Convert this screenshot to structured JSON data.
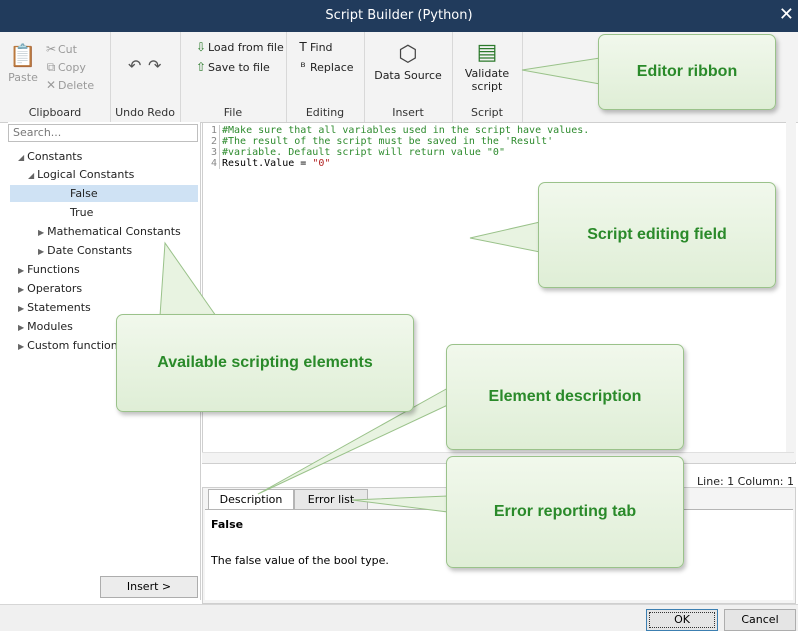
{
  "window": {
    "title": "Script Builder (Python)",
    "close_glyph": "✕"
  },
  "ribbon": {
    "clipboard": {
      "label": "Clipboard",
      "paste": "Paste",
      "cut": "Cut",
      "copy": "Copy",
      "delete": "Delete"
    },
    "undo_redo": {
      "label": "Undo Redo"
    },
    "file": {
      "label": "File",
      "load": "Load from file",
      "save": "Save to file"
    },
    "editing": {
      "label": "Editing",
      "find": "Find",
      "replace": "Replace"
    },
    "insert": {
      "label": "Insert",
      "data_source": "Data Source"
    },
    "script": {
      "label": "Script",
      "validate_line1": "Validate",
      "validate_line2": "script"
    }
  },
  "left": {
    "search_placeholder": "Search...",
    "tree": {
      "constants": "Constants",
      "logical": "Logical Constants",
      "false": "False",
      "true": "True",
      "math": "Mathematical Constants",
      "date": "Date Constants",
      "functions": "Functions",
      "operators": "Operators",
      "statements": "Statements",
      "modules": "Modules",
      "custom": "Custom functions"
    },
    "insert_button": "Insert >"
  },
  "editor": {
    "lines": [
      {
        "num": "1",
        "text": "#Make sure that all variables used in the script have values."
      },
      {
        "num": "2",
        "text": "#The result of the script must be saved in the 'Result'"
      },
      {
        "num": "3",
        "text": "#variable. Default script will return value \"0\""
      },
      {
        "num": "4",
        "code": "Result.Value = ",
        "str": "\"0\""
      }
    ],
    "status": "Line: 1 Column: 1"
  },
  "lower": {
    "tab_description": "Description",
    "tab_errors": "Error list",
    "desc_title": "False",
    "desc_text": "The false value of the bool type."
  },
  "buttons": {
    "ok": "OK",
    "cancel": "Cancel"
  },
  "callouts": {
    "ribbon": "Editor ribbon",
    "script": "Script editing field",
    "elements": "Available scripting elements",
    "description": "Element description",
    "errors": "Error reporting tab"
  },
  "colors": {
    "titlebar": "#213b5c",
    "callout_text": "#2a8a2a",
    "comment": "#2e8b2e",
    "selection": "#cfe2f4"
  },
  "icons": [
    "paste-icon",
    "cut-icon",
    "copy-icon",
    "delete-icon",
    "undo-icon",
    "redo-icon",
    "load-file-icon",
    "save-file-icon",
    "find-icon",
    "replace-icon",
    "data-source-icon",
    "validate-script-icon"
  ]
}
